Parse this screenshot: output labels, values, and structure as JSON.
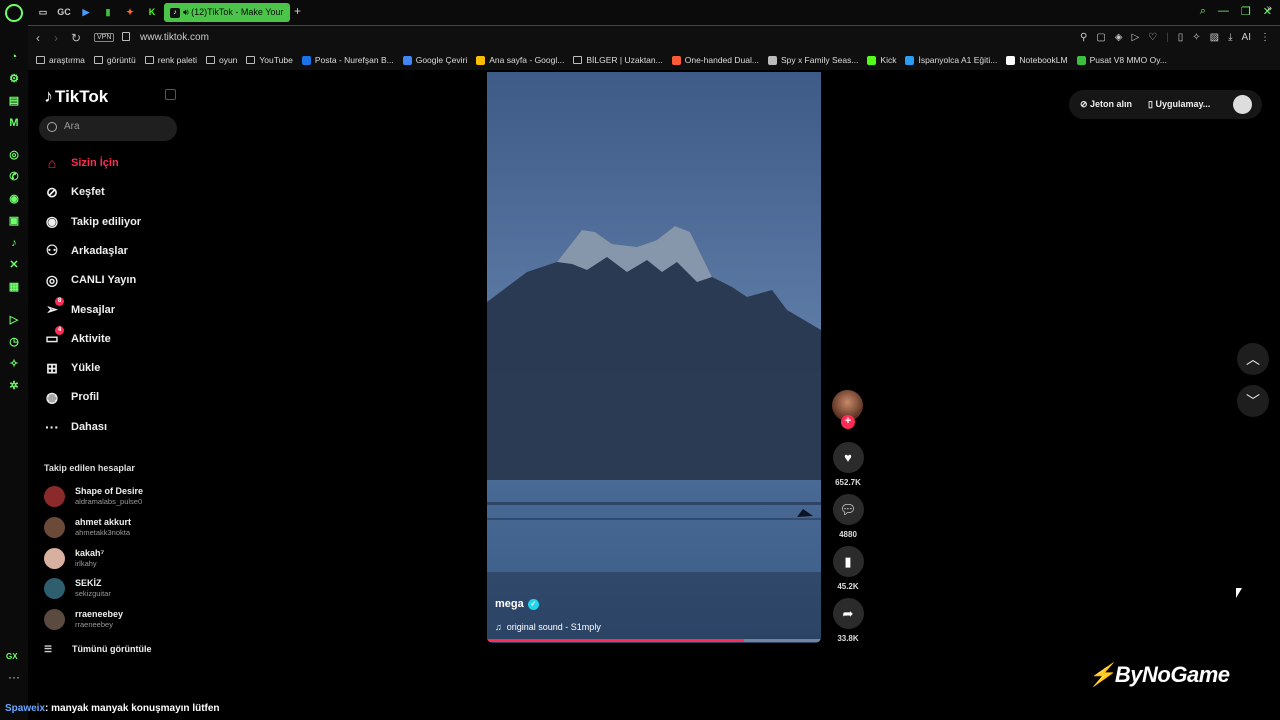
{
  "browser": {
    "active_tab_title": "(12)TikTok - Make Your",
    "url": "www.tiktok.com",
    "vpn_label": "VPN",
    "gx_label": "GX",
    "pinned_tabs": [
      "GC"
    ],
    "bookmarks": [
      {
        "label": "araştırma",
        "icon": "folder"
      },
      {
        "label": "görüntü",
        "icon": "folder"
      },
      {
        "label": "renk paleti",
        "icon": "folder"
      },
      {
        "label": "oyun",
        "icon": "folder"
      },
      {
        "label": "YouTube",
        "icon": "page"
      },
      {
        "label": "Posta - Nurefşan B...",
        "icon": "outlook",
        "color": "#1a73e8"
      },
      {
        "label": "Google Çeviri",
        "icon": "translate",
        "color": "#4285f4"
      },
      {
        "label": "Ana sayfa - Googl...",
        "icon": "drive",
        "color": "#fbbc04"
      },
      {
        "label": "BİLGER | Uzaktan...",
        "icon": "page"
      },
      {
        "label": "One-handed Dual...",
        "icon": "app",
        "color": "#ff5a36"
      },
      {
        "label": "Spy x Family Seas...",
        "icon": "app",
        "color": "#bbbbbb"
      },
      {
        "label": "Kick",
        "icon": "kick",
        "color": "#53fc18"
      },
      {
        "label": "İspanyolca A1 Eğiti...",
        "icon": "app",
        "color": "#2a9df4"
      },
      {
        "label": "NotebookLM",
        "icon": "app",
        "color": "#ffffff"
      },
      {
        "label": "Pusat V8 MMO Oy...",
        "icon": "app",
        "color": "#3fbf3f"
      }
    ],
    "addr_icon_ai": "AI"
  },
  "sidebar": {
    "logo": "TikTok",
    "search_placeholder": "Ara",
    "nav": [
      {
        "label": "Sizin İçin",
        "icon": "home-icon",
        "active": true
      },
      {
        "label": "Keşfet",
        "icon": "compass-icon"
      },
      {
        "label": "Takip ediliyor",
        "icon": "following-avatar-icon"
      },
      {
        "label": "Arkadaşlar",
        "icon": "friends-icon"
      },
      {
        "label": "CANLI Yayın",
        "icon": "live-icon"
      },
      {
        "label": "Mesajlar",
        "icon": "messages-icon",
        "badge": "8"
      },
      {
        "label": "Aktivite",
        "icon": "activity-icon",
        "badge": "4"
      },
      {
        "label": "Yükle",
        "icon": "upload-icon"
      },
      {
        "label": "Profil",
        "icon": "profile-avatar-icon"
      },
      {
        "label": "Dahası",
        "icon": "more-icon"
      }
    ],
    "following_title": "Takip edilen hesaplar",
    "following": [
      {
        "name": "Shape of Desire",
        "handle": "aldramalabs_pulse0",
        "color": "#8a2a2a"
      },
      {
        "name": "ahmet akkurt",
        "handle": "ahmetakk3nokta",
        "color": "#6b4a3a"
      },
      {
        "name": "kakah⁷",
        "handle": "irlkahy",
        "color": "#d8b0a0"
      },
      {
        "name": "SEKİZ",
        "handle": "sekizguitar",
        "color": "#2f5f6f"
      },
      {
        "name": "rraeneebey",
        "handle": "rraeneebey",
        "color": "#5a4a40"
      }
    ],
    "see_all": "Tümünü görüntüle"
  },
  "video": {
    "author": "mega",
    "sound": "original sound - S1mply",
    "progress": 0.77,
    "colors": {
      "sky_top": "#3e5a86",
      "sky_bottom": "#6e8fb8",
      "mountain": "#2a3a52",
      "snow": "#b8c8dc",
      "water": "#3a5a86"
    }
  },
  "actions": {
    "likes": "652.7K",
    "comments": "4880",
    "saves": "45.2K",
    "shares": "33.8K"
  },
  "topbar": {
    "get_coins": "Jeton alın",
    "get_app": "Uygulamay..."
  },
  "watermark": "ByNoGame",
  "chat": {
    "user": "Spaweix",
    "message": ": manyak manyak konuşmayın lütfen"
  },
  "accent": "#fe2c55"
}
